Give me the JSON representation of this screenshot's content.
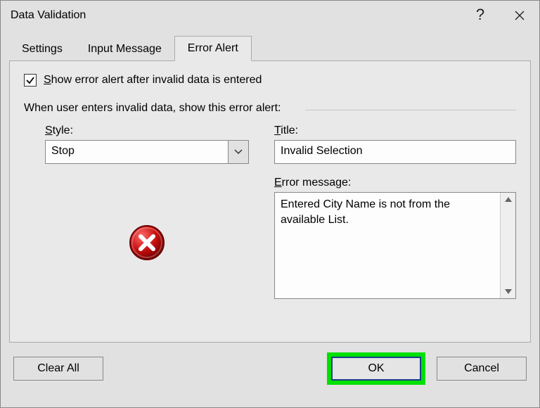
{
  "window": {
    "title": "Data Validation"
  },
  "tabs": {
    "settings": "Settings",
    "input_message": "Input Message",
    "error_alert": "Error Alert",
    "active_index": 2
  },
  "content": {
    "show_alert_checked": true,
    "show_alert_label": "Show error alert after invalid data is entered",
    "section_label": "When user enters invalid data, show this error alert:",
    "style_label": "Style:",
    "style_value": "Stop",
    "title_label": "Title:",
    "title_value": "Invalid Selection",
    "message_label": "Error message:",
    "message_value": "Entered City Name is not from the available List."
  },
  "buttons": {
    "clear_all": "Clear All",
    "ok": "OK",
    "cancel": "Cancel"
  }
}
